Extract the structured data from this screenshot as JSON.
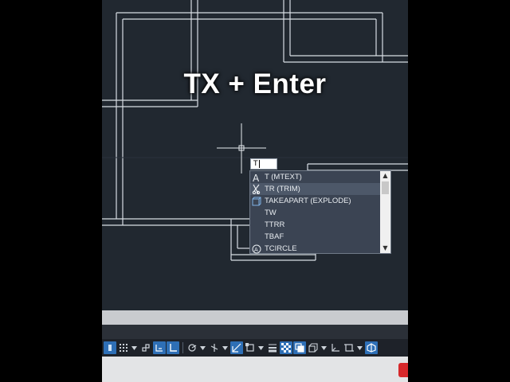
{
  "caption": "TX + Enter",
  "command_input": {
    "value": "T"
  },
  "autocomplete": {
    "items": [
      {
        "label": "T (MTEXT)",
        "icon": "mtext-icon",
        "selected": false
      },
      {
        "label": "TR (TRIM)",
        "icon": "trim-icon",
        "selected": true
      },
      {
        "label": "TAKEAPART (EXPLODE)",
        "icon": "explode-icon",
        "selected": false
      },
      {
        "label": "TW",
        "icon": "",
        "selected": false
      },
      {
        "label": "TTRR",
        "icon": "",
        "selected": false
      },
      {
        "label": "TBAF",
        "icon": "",
        "selected": false
      },
      {
        "label": "TCIRCLE",
        "icon": "tcircle-icon",
        "selected": false
      }
    ]
  },
  "statusbar": {
    "buttons": [
      "grid-icon",
      "snap-icon",
      "infer-constraints-icon",
      "ortho-icon",
      "polar-tracking-icon",
      "isometric-icon",
      "object-snap-tracking-icon",
      "object-snap-icon",
      "lineweight-icon",
      "transparency-icon",
      "selection-cycling-icon",
      "3d-osnap-icon",
      "dynamic-ucs-icon",
      "selection-filter-icon",
      "gizmo-icon"
    ]
  },
  "colors": {
    "canvas": "#212830",
    "geometry_lines": "#d8dde3",
    "popup_bg": "#3b4453",
    "popup_selected": "#4d5869",
    "status_active": "#2e6fb6",
    "badge_red": "#d6282b"
  }
}
